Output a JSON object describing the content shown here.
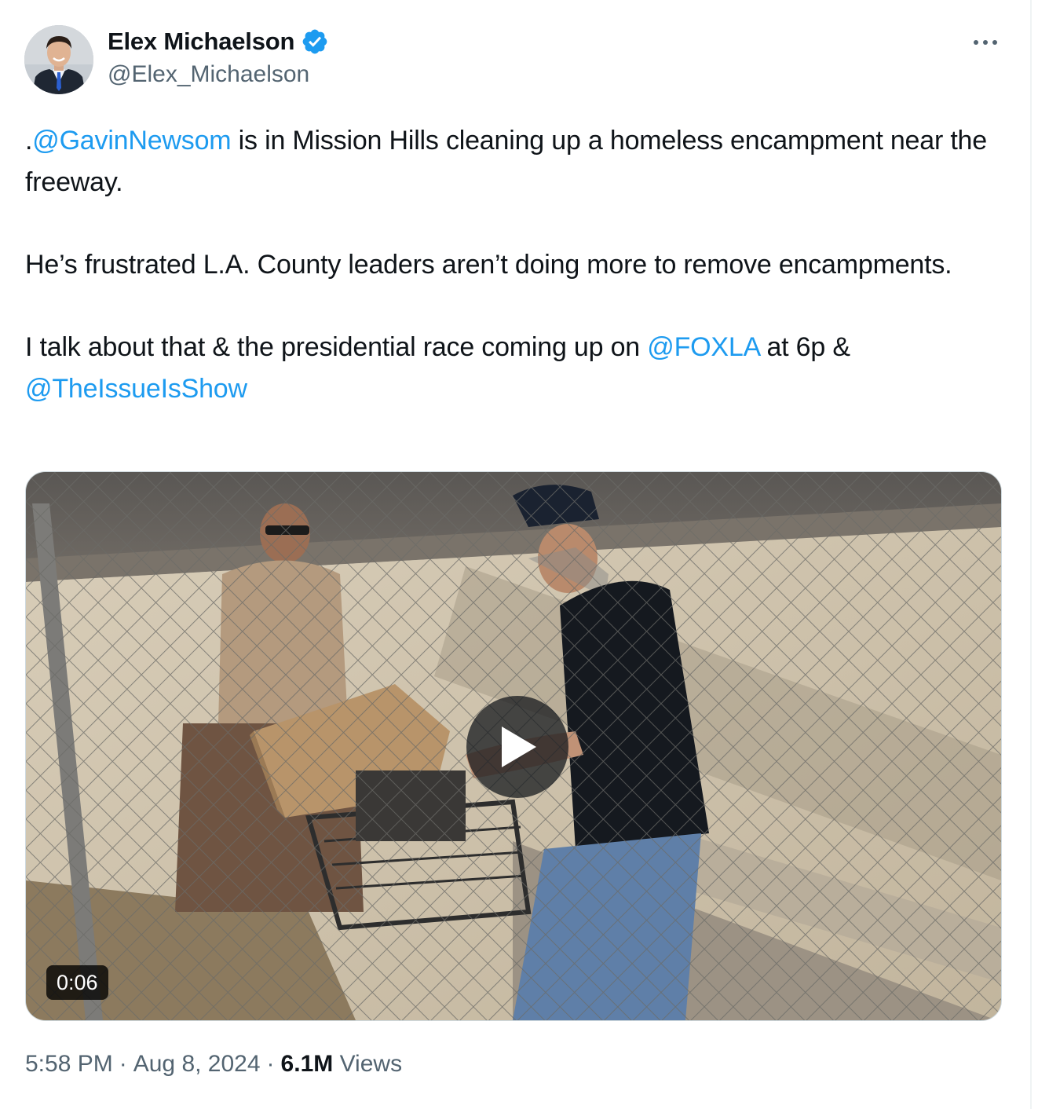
{
  "author": {
    "display_name": "Elex Michaelson",
    "handle": "@Elex_Michaelson",
    "verified": true,
    "avatar_icon": "profile-photo-avatar"
  },
  "tweet": {
    "paragraph1": {
      "prefix": ".",
      "mention": "@GavinNewsom",
      "text": " is in Mission Hills cleaning up a homeless encampment near the freeway."
    },
    "paragraph2": "He’s frustrated L.A. County leaders aren’t doing more to remove encampments.",
    "paragraph3": {
      "text_before": "I talk about that & the presidential race coming up on ",
      "mention1": "@FOXLA",
      "text_middle": " at 6p & ",
      "mention2": "@TheIssueIsShow"
    }
  },
  "media": {
    "type": "video",
    "duration": "0:06",
    "play_icon": "play-icon"
  },
  "meta": {
    "time": "5:58 PM",
    "date": "Aug 8, 2024",
    "separator": "·",
    "views_count": "6.1M",
    "views_label": "Views"
  },
  "colors": {
    "text_primary": "#0f1419",
    "text_secondary": "#536471",
    "link": "#1d9bf0",
    "verified_badge": "#1d9bf0",
    "border": "#cfd9de"
  }
}
